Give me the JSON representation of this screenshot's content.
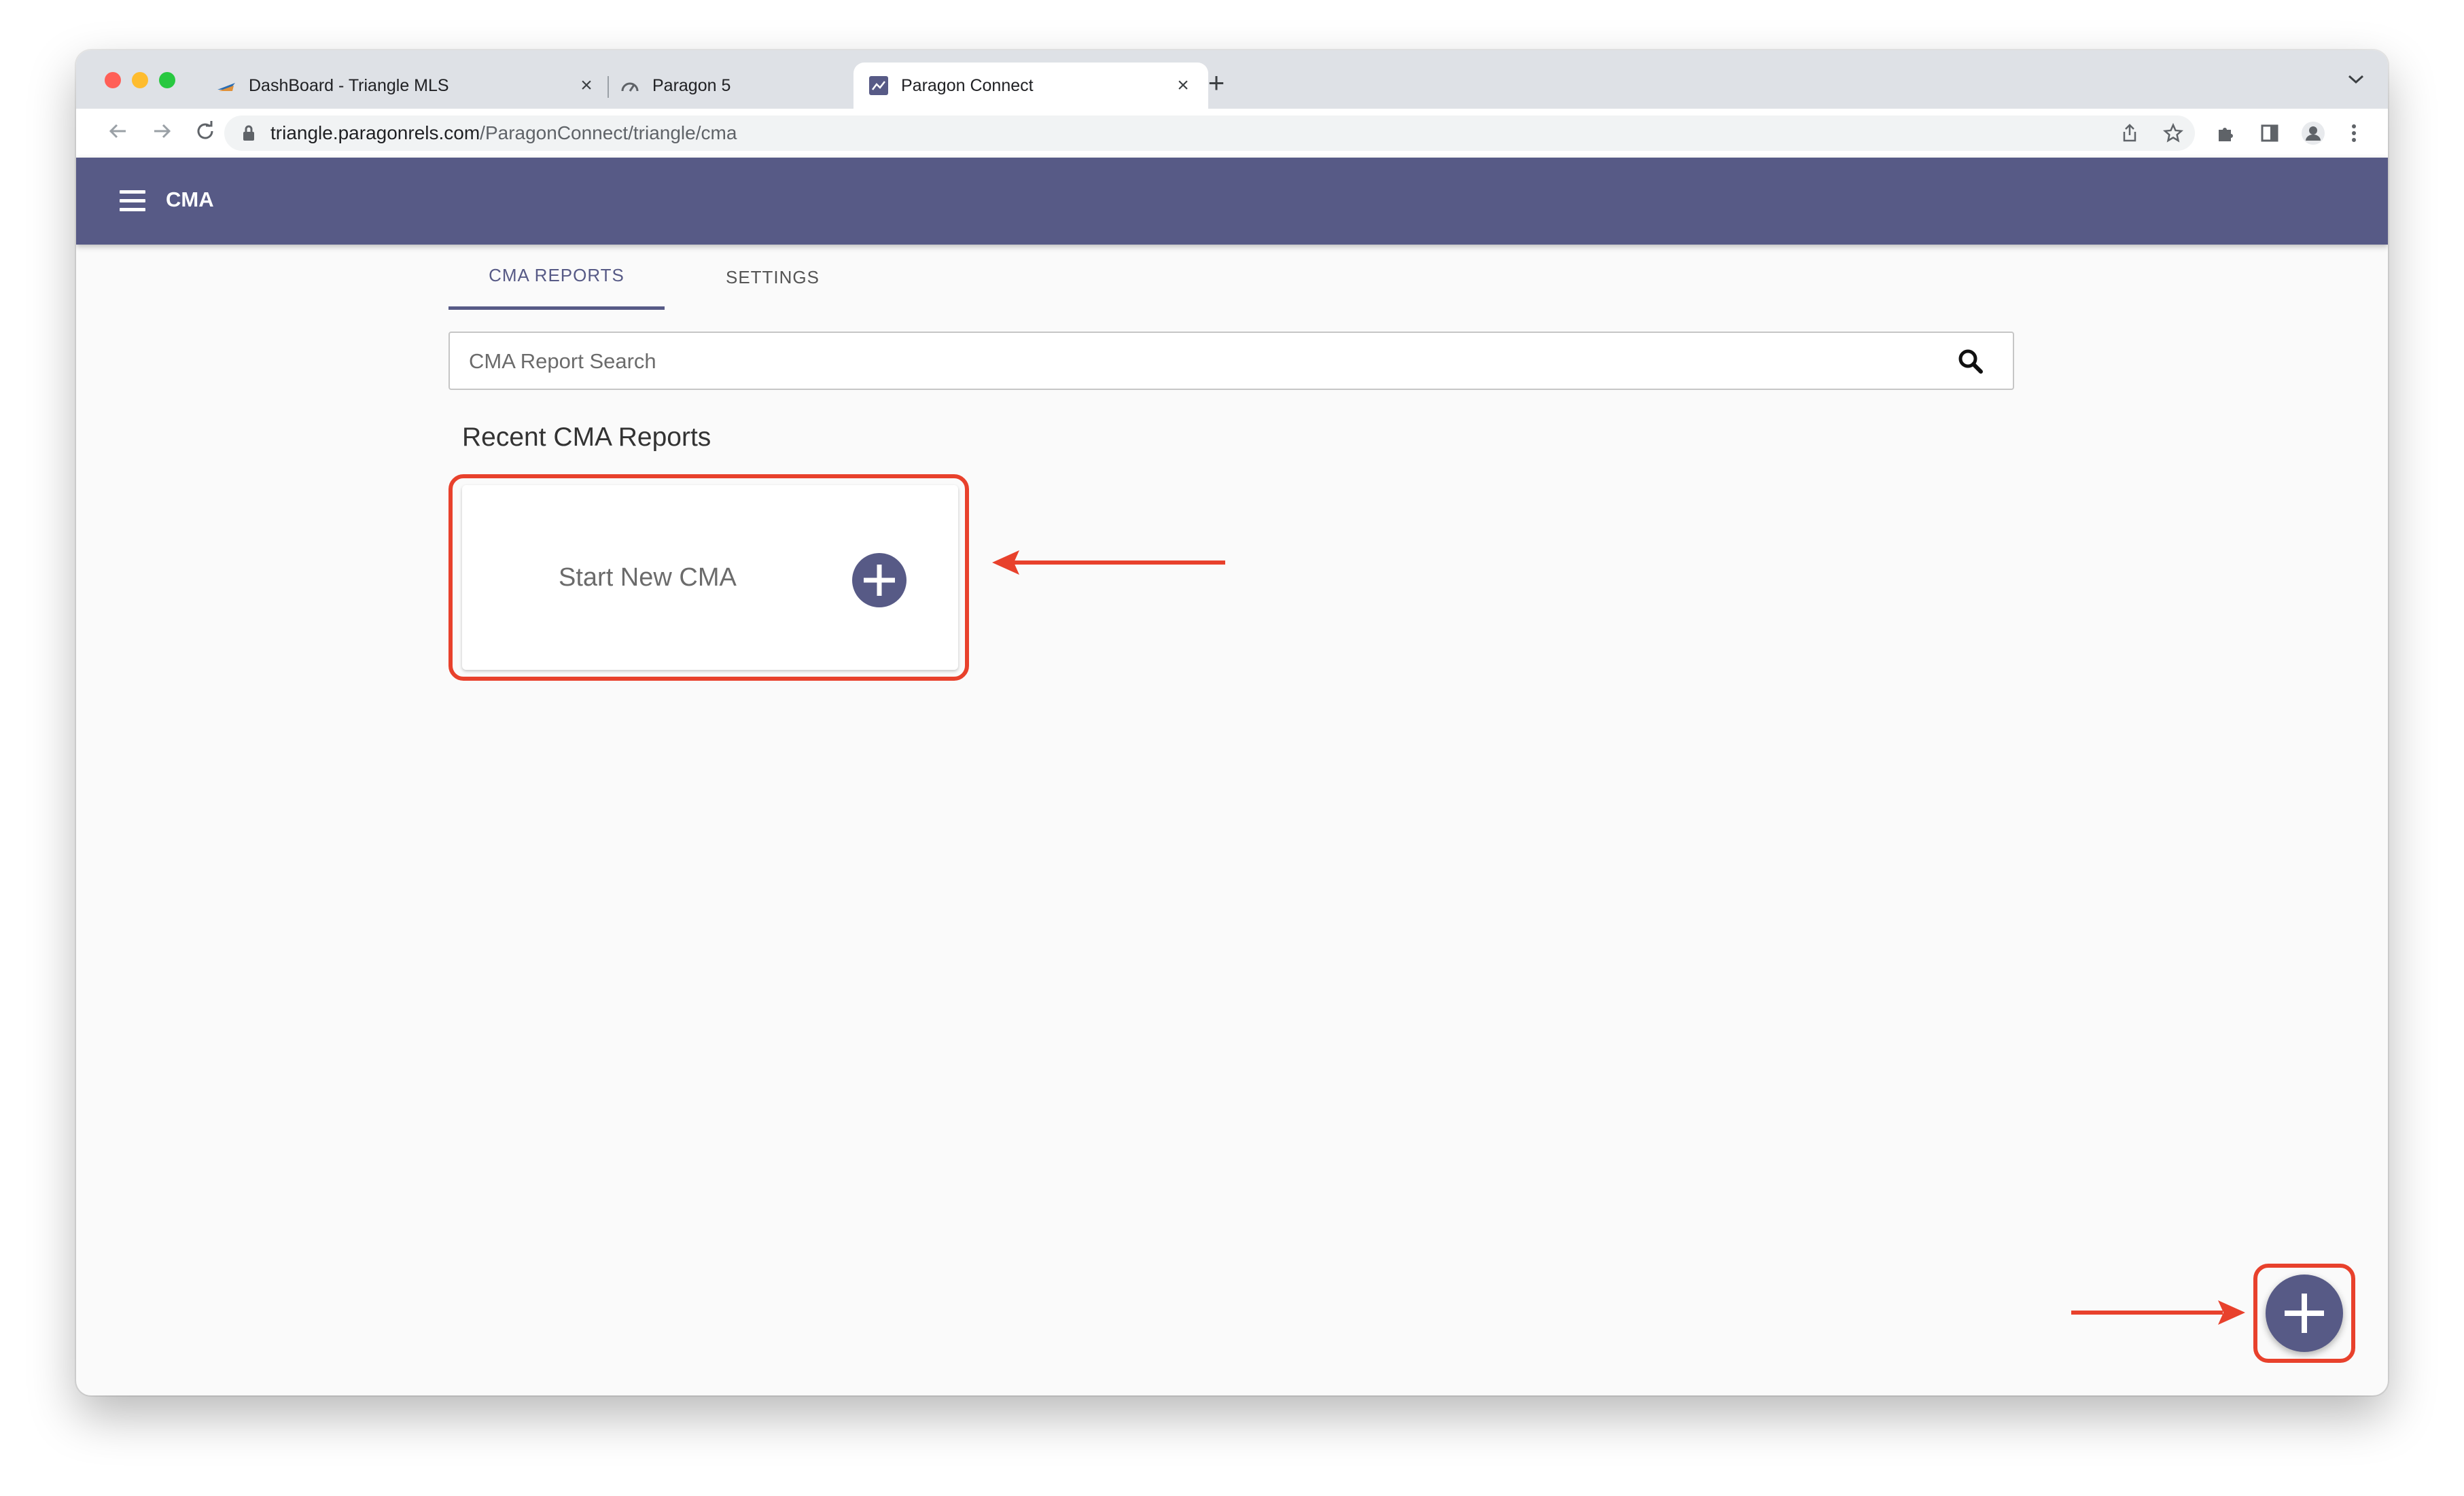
{
  "browser": {
    "tabs": [
      {
        "title": "DashBoard - Triangle MLS",
        "close": "×"
      },
      {
        "title": "Paragon 5",
        "close": "×"
      },
      {
        "title": "Paragon Connect",
        "close": "×"
      }
    ],
    "new_tab": "+",
    "url_host": "triangle.paragonrels.com",
    "url_path": "/ParagonConnect/triangle/cma"
  },
  "app": {
    "title": "CMA",
    "header_color": "#575a86"
  },
  "content_tabs": [
    {
      "label": "CMA REPORTS",
      "active": true
    },
    {
      "label": "SETTINGS",
      "active": false
    }
  ],
  "search": {
    "placeholder": "CMA Report Search",
    "value": ""
  },
  "recent": {
    "title": "Recent CMA Reports",
    "new_card_label": "Start New CMA"
  },
  "annotation_color": "#e8412c",
  "icons": [
    "hamburger-icon",
    "search-icon",
    "plus-circle-icon",
    "lock-icon",
    "back-arrow-icon",
    "forward-arrow-icon",
    "reload-icon",
    "share-icon",
    "star-icon",
    "puzzle-icon",
    "side-panel-icon",
    "profile-icon",
    "more-vert-icon"
  ]
}
